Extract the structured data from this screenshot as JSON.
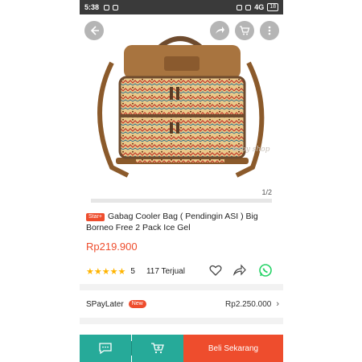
{
  "status_bar": {
    "time": "5:38",
    "network": "4G",
    "battery": "18"
  },
  "gallery": {
    "counter": "1/2",
    "watermark": "baby shop",
    "icons": [
      "back-arrow-icon",
      "share-icon",
      "cart-icon",
      "more-vertical-icon"
    ]
  },
  "product": {
    "badge": "Star+",
    "title": "Gabag Cooler Bag ( Pendingin ASI ) Big Borneo Free 2 Pack Ice Gel",
    "price": "Rp219.900",
    "rating": "5",
    "sold": "117 Terjual",
    "stars_filled": 5
  },
  "paylater": {
    "label": "SPayLater",
    "badge": "New",
    "amount": "Rp2.250.000"
  },
  "bottom_bar": {
    "buy_label": "Beli Sekarang"
  },
  "colors": {
    "accent": "#ee4d2d",
    "teal": "#26aa99",
    "star": "#ffb400"
  }
}
